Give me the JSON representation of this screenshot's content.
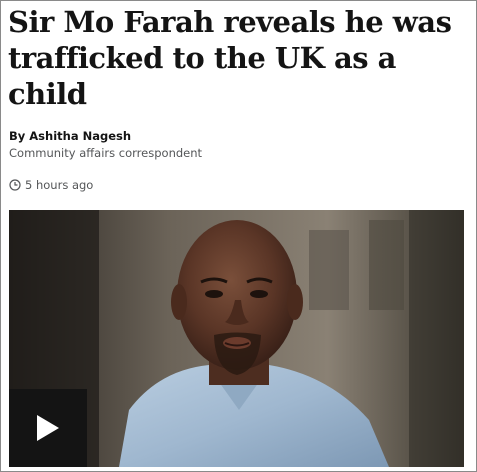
{
  "article": {
    "headline": "Sir Mo Farah reveals he was trafficked to the UK as a child",
    "byline": "By Ashitha Nagesh",
    "role": "Community affairs correspondent",
    "timestamp": "5 hours ago"
  },
  "media": {
    "play_icon": "play-icon",
    "clock_icon": "clock-icon"
  }
}
